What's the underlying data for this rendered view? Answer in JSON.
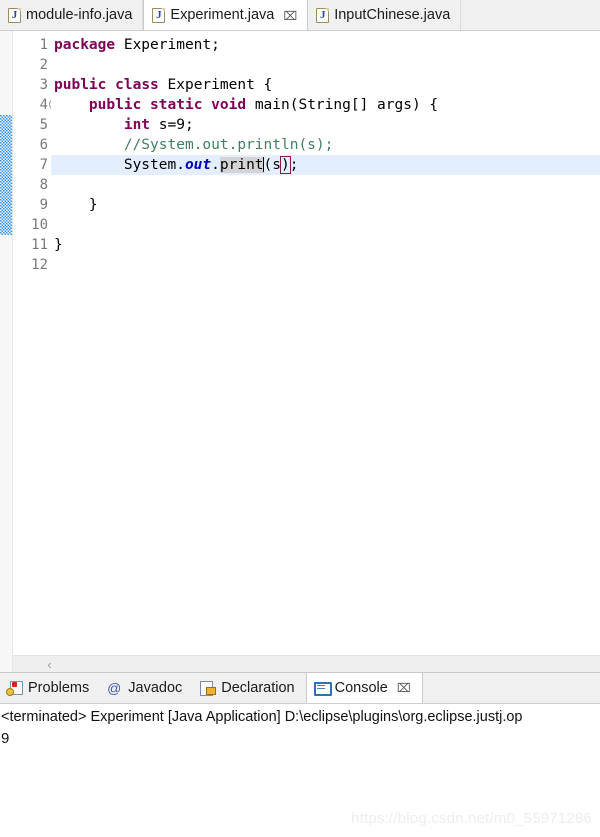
{
  "editor_tabs": [
    {
      "label": "module-info.java",
      "icon": "java-file-icon",
      "active": false,
      "closable": false
    },
    {
      "label": "Experiment.java",
      "icon": "java-file-icon",
      "active": true,
      "closable": true,
      "close_glyph": "⌧"
    },
    {
      "label": "InputChinese.java",
      "icon": "java-file-icon",
      "active": false,
      "closable": false
    }
  ],
  "editor": {
    "line_numbers": [
      "1",
      "2",
      "3",
      "4",
      "5",
      "6",
      "7",
      "8",
      "9",
      "10",
      "11",
      "12"
    ],
    "current_line": "7",
    "fold_marker_line": "4",
    "lines": [
      {
        "n": "1",
        "text": "package Experiment;"
      },
      {
        "n": "2",
        "text": ""
      },
      {
        "n": "3",
        "text": "public class Experiment {"
      },
      {
        "n": "4",
        "text": "    public static void main(String[] args) {"
      },
      {
        "n": "5",
        "text": "        int s=9;"
      },
      {
        "n": "6",
        "text": "        //System.out.println(s);"
      },
      {
        "n": "7",
        "text": "        System.out.print(s);"
      },
      {
        "n": "8",
        "text": ""
      },
      {
        "n": "9",
        "text": "    }"
      },
      {
        "n": "10",
        "text": ""
      },
      {
        "n": "11",
        "text": "}"
      },
      {
        "n": "12",
        "text": ""
      }
    ],
    "tokens": {
      "kw_package": "package",
      "kw_public": "public",
      "kw_class": "class",
      "kw_static": "static",
      "kw_void": "void",
      "kw_int": "int",
      "name_experiment_pkg": " Experiment;",
      "name_experiment_cls": " Experiment {",
      "main_sig": " main(String[] args) {",
      "int_decl": " s=9;",
      "comment": "//System.out.println(s);",
      "sys_prefix": "System.",
      "field_out": "out",
      "dot": ".",
      "occurrence_print": "print",
      "open_paren": "(s",
      "close_paren": ")",
      "semicolon": ";",
      "close_brace": "}",
      "close_brace_outer": "}"
    },
    "scroll_left_arrow": "‹"
  },
  "view_tabs": [
    {
      "label": "Problems",
      "icon": "problems-icon",
      "active": false,
      "closable": false
    },
    {
      "label": "Javadoc",
      "icon": "javadoc-icon",
      "glyph": "@",
      "active": false,
      "closable": false
    },
    {
      "label": "Declaration",
      "icon": "declaration-icon",
      "active": false,
      "closable": false
    },
    {
      "label": "Console",
      "icon": "console-icon",
      "active": true,
      "closable": true,
      "close_glyph": "⌧"
    }
  ],
  "console": {
    "header": "<terminated> Experiment [Java Application] D:\\eclipse\\plugins\\org.eclipse.justj.op",
    "output": "9"
  },
  "watermark": "https://blog.csdn.net/m0_55971286",
  "colors": {
    "keyword": "#7f0055",
    "comment": "#3f7f5f",
    "field": "#0000c0",
    "current_line_bg": "#e3efff",
    "occurrence_bg": "#d4d4d4",
    "bracket_outline": "#8c1a3d",
    "fold_strip": "#2f8fe0"
  }
}
